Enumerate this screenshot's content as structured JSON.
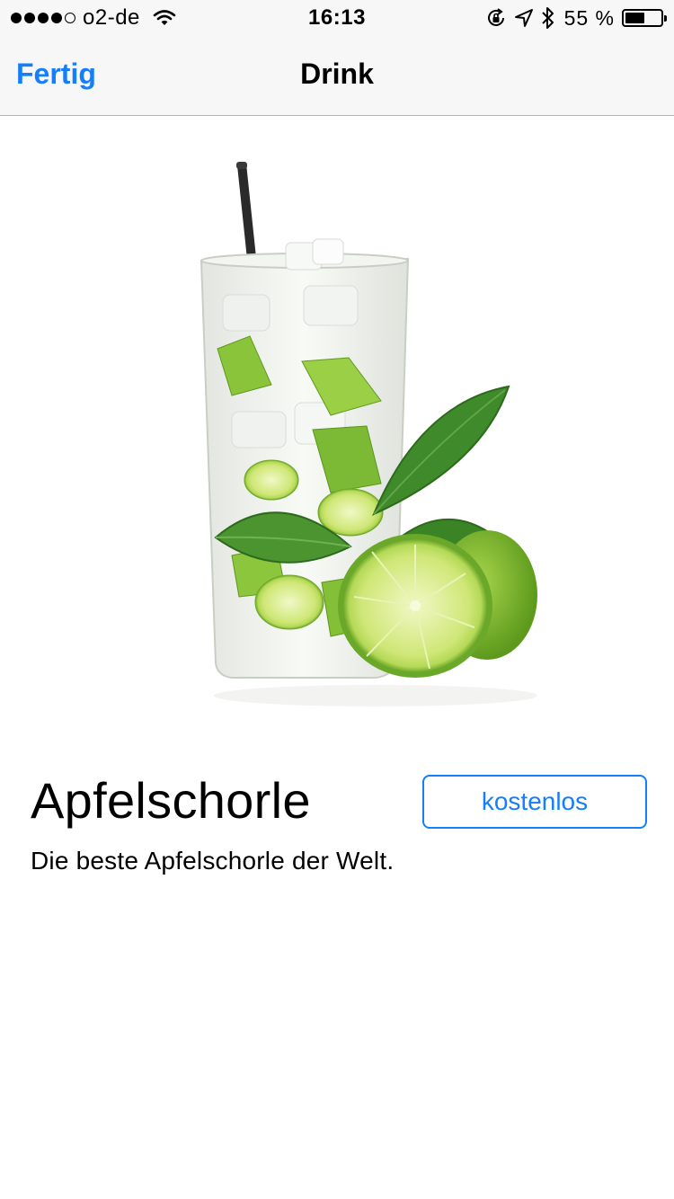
{
  "status_bar": {
    "carrier": "o2-de",
    "signal_bars_filled": 4,
    "signal_bars_total": 5,
    "time": "16:13",
    "battery_percent_label": "55 %",
    "battery_level": 0.55
  },
  "nav": {
    "back_label": "Fertig",
    "title": "Drink"
  },
  "drink": {
    "name": "Apfelschorle",
    "price_label": "kostenlos",
    "description": "Die beste Apfelschorle der Welt."
  },
  "colors": {
    "accent": "#147efb",
    "bar_background": "#f7f7f7"
  },
  "icons": [
    "wifi-icon",
    "orientation-lock-icon",
    "location-arrow-icon",
    "bluetooth-icon",
    "battery-icon"
  ]
}
